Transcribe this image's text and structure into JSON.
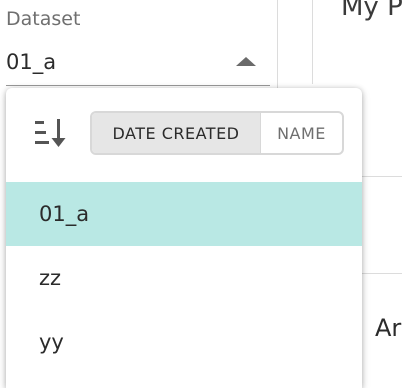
{
  "background": {
    "dataset_label": "Dataset",
    "dataset_value": "01_a",
    "title_partial": "My P",
    "right_text_partial": "Ar"
  },
  "dropdown": {
    "sort_toggle": {
      "options": [
        "DATE CREATED",
        "NAME"
      ],
      "selected": "DATE CREATED"
    },
    "items": [
      {
        "label": "01_a",
        "selected": true
      },
      {
        "label": "zz",
        "selected": false
      },
      {
        "label": "yy",
        "selected": false
      }
    ]
  },
  "colors": {
    "selected_item_bg": "#b9e8e4",
    "active_toggle_bg": "#e6e6e6"
  }
}
